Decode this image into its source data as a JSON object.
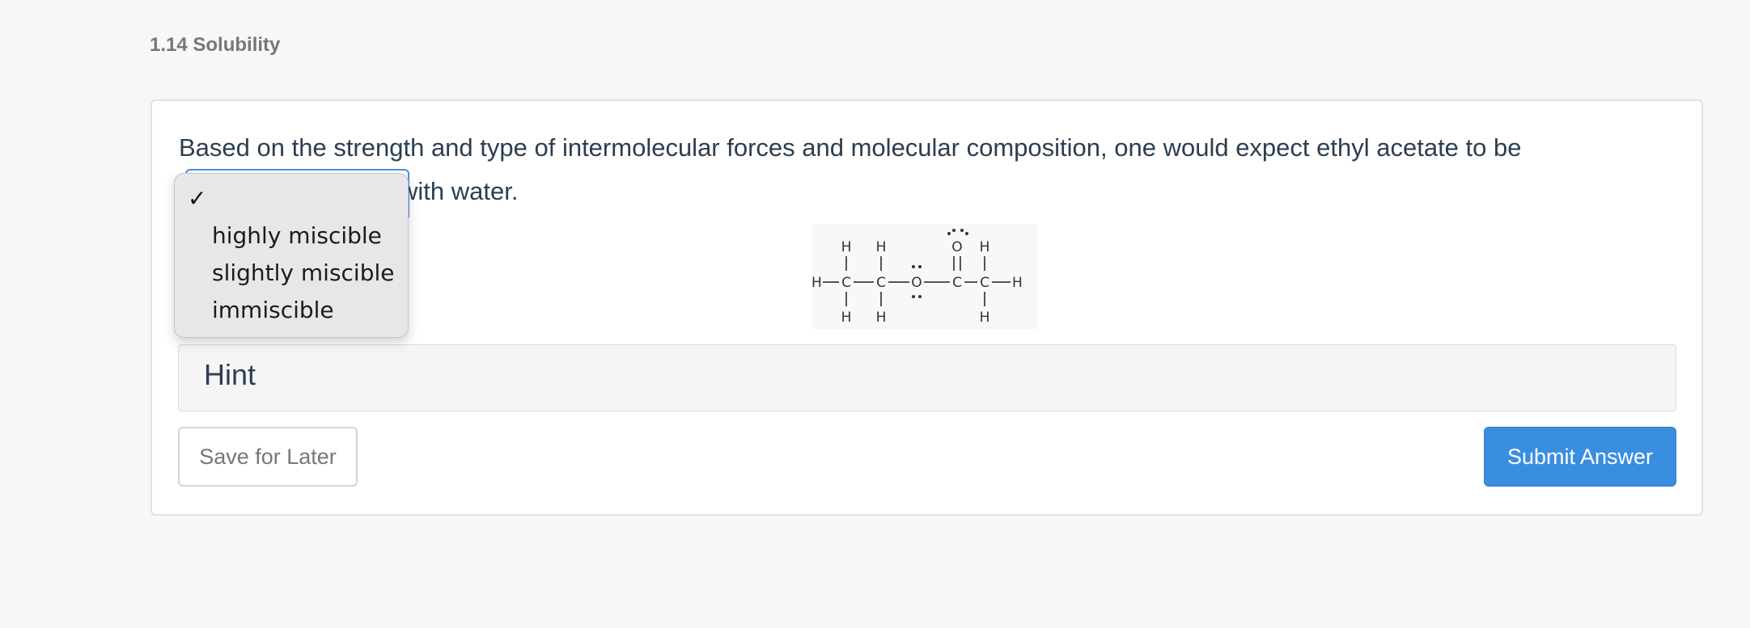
{
  "breadcrumb": "1.14 Solubility",
  "question": {
    "text_line1": "Based on the strength and type of intermolecular forces and molecular composition, one would expect ethyl acetate to be",
    "text_line2": "with water."
  },
  "dropdown": {
    "selected_mark": "✓",
    "options": [
      "highly miscible",
      "slightly miscible",
      "immiscible"
    ]
  },
  "molecule": {
    "atoms": [
      "H",
      "H",
      "H",
      "C",
      "C",
      "O",
      "C",
      "C",
      "H",
      "H",
      "H",
      "H",
      "H",
      "O",
      "H"
    ]
  },
  "hint": {
    "label": "Hint"
  },
  "buttons": {
    "save_label": "Save for Later",
    "submit_label": "Submit Answer"
  },
  "colors": {
    "accent": "#3a8ee0",
    "text": "#2c3e50",
    "background": "#f7f7f7"
  }
}
